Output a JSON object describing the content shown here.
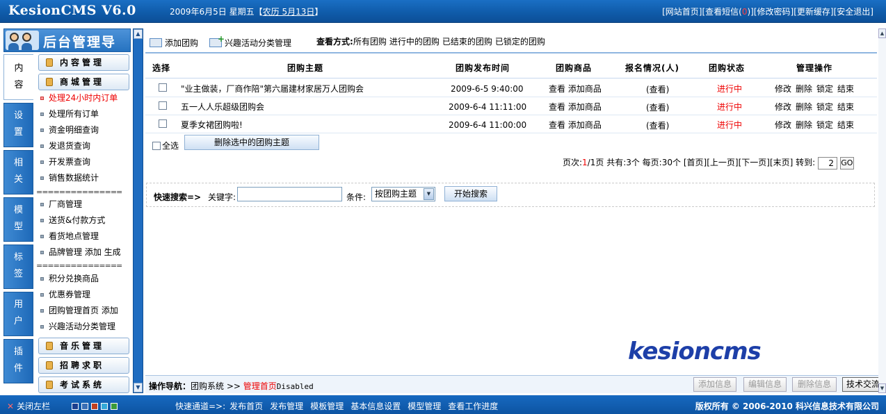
{
  "header": {
    "logo": "KesionCMS V6.0",
    "date": "2009年6月5日 星期五【",
    "lunar": "农历 5月13日",
    "date_end": "】",
    "links": [
      "[网站首页]",
      "[查看短信(",
      "0",
      ")]",
      "[修改密码]",
      "[更新缓存]",
      "[安全退出]"
    ]
  },
  "sidebar": {
    "title": "后台管理导航",
    "tabs": [
      {
        "label": "内容",
        "active": true
      },
      {
        "label": "设置"
      },
      {
        "label": "相关"
      },
      {
        "label": "模型"
      },
      {
        "label": "标签"
      },
      {
        "label": "用户"
      },
      {
        "label": "插件"
      }
    ],
    "heads": [
      "内容管理",
      "商城管理",
      "音乐管理",
      "招聘求职",
      "考试系统"
    ],
    "items": [
      "处理24小时内订单",
      "处理所有订单",
      "资金明细查询",
      "发退货查询",
      "开发票查询",
      "销售数据统计",
      "厂商管理",
      "送货&付款方式",
      "看货地点管理",
      "品牌管理 添加 生成",
      "积分兑换商品",
      "优惠券管理",
      "团购管理首页 添加",
      "兴趣活动分类管理"
    ],
    "separator": "===================="
  },
  "toolbar": {
    "add_label": "添加团购",
    "category_label": "兴趣活动分类管理",
    "view_label": "查看方式:",
    "view_options": [
      "所有团购",
      "进行中的团购",
      "已结束的团购",
      "已锁定的团购"
    ]
  },
  "table": {
    "headers": [
      "选择",
      "团购主题",
      "团购发布时间",
      "团购商品",
      "报名情况(人)",
      "团购状态",
      "管理操作"
    ],
    "rows": [
      {
        "title": "\"业主做装，厂商作陪\"第六届建材家居万人团购会",
        "time": "2009-6-5 9:40:00",
        "goods": "查看 添加商品",
        "signup": "(查看)",
        "status": "进行中"
      },
      {
        "title": "五一人人乐超级团购会",
        "time": "2009-6-4 11:11:00",
        "goods": "查看 添加商品",
        "signup": "(查看)",
        "status": "进行中"
      },
      {
        "title": "夏季女裙团购啦!",
        "time": "2009-6-4 11:00:00",
        "goods": "查看 添加商品",
        "signup": "(查看)",
        "status": "进行中"
      }
    ],
    "actions": [
      "修改",
      "删除",
      "锁定",
      "结束"
    ],
    "select_all": "全选",
    "delete_button": "删除选中的团购主题"
  },
  "pager": {
    "label": "页次:",
    "current": "1",
    "total": "/1页",
    "rest": " 共有:3个 每页:30个 ",
    "links": [
      "[首页]",
      "[上一页]",
      "[下一页]",
      "[末页]"
    ],
    "goto": "转到:",
    "page_value": "2",
    "go": "GO"
  },
  "search": {
    "label": "快速搜索=>",
    "keyword_label": "关键字:",
    "keyword_value": "",
    "condition_label": "条件:",
    "condition_selected": "按团购主题",
    "button": "开始搜索"
  },
  "watermark": "kesioncms",
  "opnav": {
    "label": "操作导航：",
    "system": "团购系统",
    "sep": " >> ",
    "page": "管理首页",
    "suffix": "Disabled",
    "buttons": [
      "添加信息",
      "编辑信息",
      "删除信息",
      "技术交流"
    ]
  },
  "footer": {
    "close": "关闭左栏",
    "swatch_colors": [
      "#1b3f8f",
      "#3a6fb5",
      "#c04020",
      "#33a9d8",
      "#3a9a3a"
    ],
    "quick_label": "快速通道=>:",
    "quick_links": [
      "发布首页",
      "发布管理",
      "模板管理",
      "基本信息设置",
      "模型管理",
      "查看工作进度"
    ],
    "copyright": "版权所有 © 2006-2010 科兴信息技术有限公司"
  }
}
